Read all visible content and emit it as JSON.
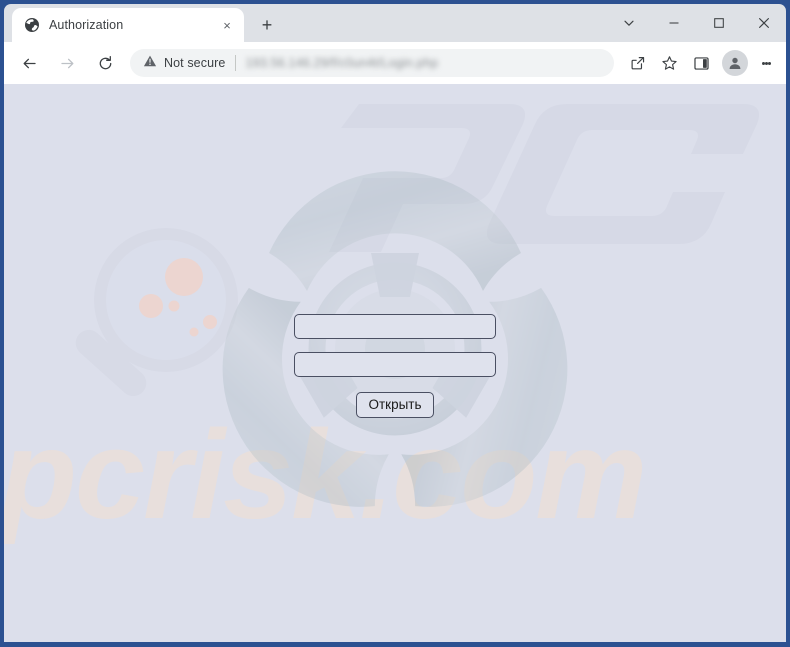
{
  "window": {
    "frame_color": "#2c5191",
    "controls": [
      {
        "name": "tab-search",
        "icon": "chevron-down-icon"
      },
      {
        "name": "minimize",
        "icon": "minimize-icon"
      },
      {
        "name": "maximize",
        "icon": "maximize-icon"
      },
      {
        "name": "close",
        "icon": "close-icon"
      }
    ]
  },
  "tab_strip": {
    "tabs": [
      {
        "title": "Authorization",
        "favicon": "globe-icon",
        "close_label": "×",
        "active": true
      }
    ],
    "new_tab_label": "+"
  },
  "toolbar": {
    "back_label": "←",
    "forward_label": "→",
    "reload_label": "⟳",
    "security_text": "Not secure",
    "security_icon": "warning-triangle-icon",
    "url": "193.56.146.29/f/c0un4t/Login.php",
    "url_blurred": true,
    "actions": [
      {
        "name": "share-icon"
      },
      {
        "name": "bookmark-star-icon"
      },
      {
        "name": "side-panel-icon"
      },
      {
        "name": "profile-avatar-icon"
      },
      {
        "name": "kebab-menu-icon"
      }
    ]
  },
  "page": {
    "background_color": "#dcdfeb",
    "artwork": {
      "biohazard": "biohazard-symbol",
      "brand_mark": "pc-letter-mark",
      "magnifier": "magnifier-virus-icon",
      "wordmark_text": "pcrisk.com",
      "wordmark_color": "#e8ddd6"
    },
    "form": {
      "username": {
        "value": "",
        "placeholder": ""
      },
      "password": {
        "value": "",
        "placeholder": ""
      },
      "submit_label": "Открыть"
    }
  }
}
